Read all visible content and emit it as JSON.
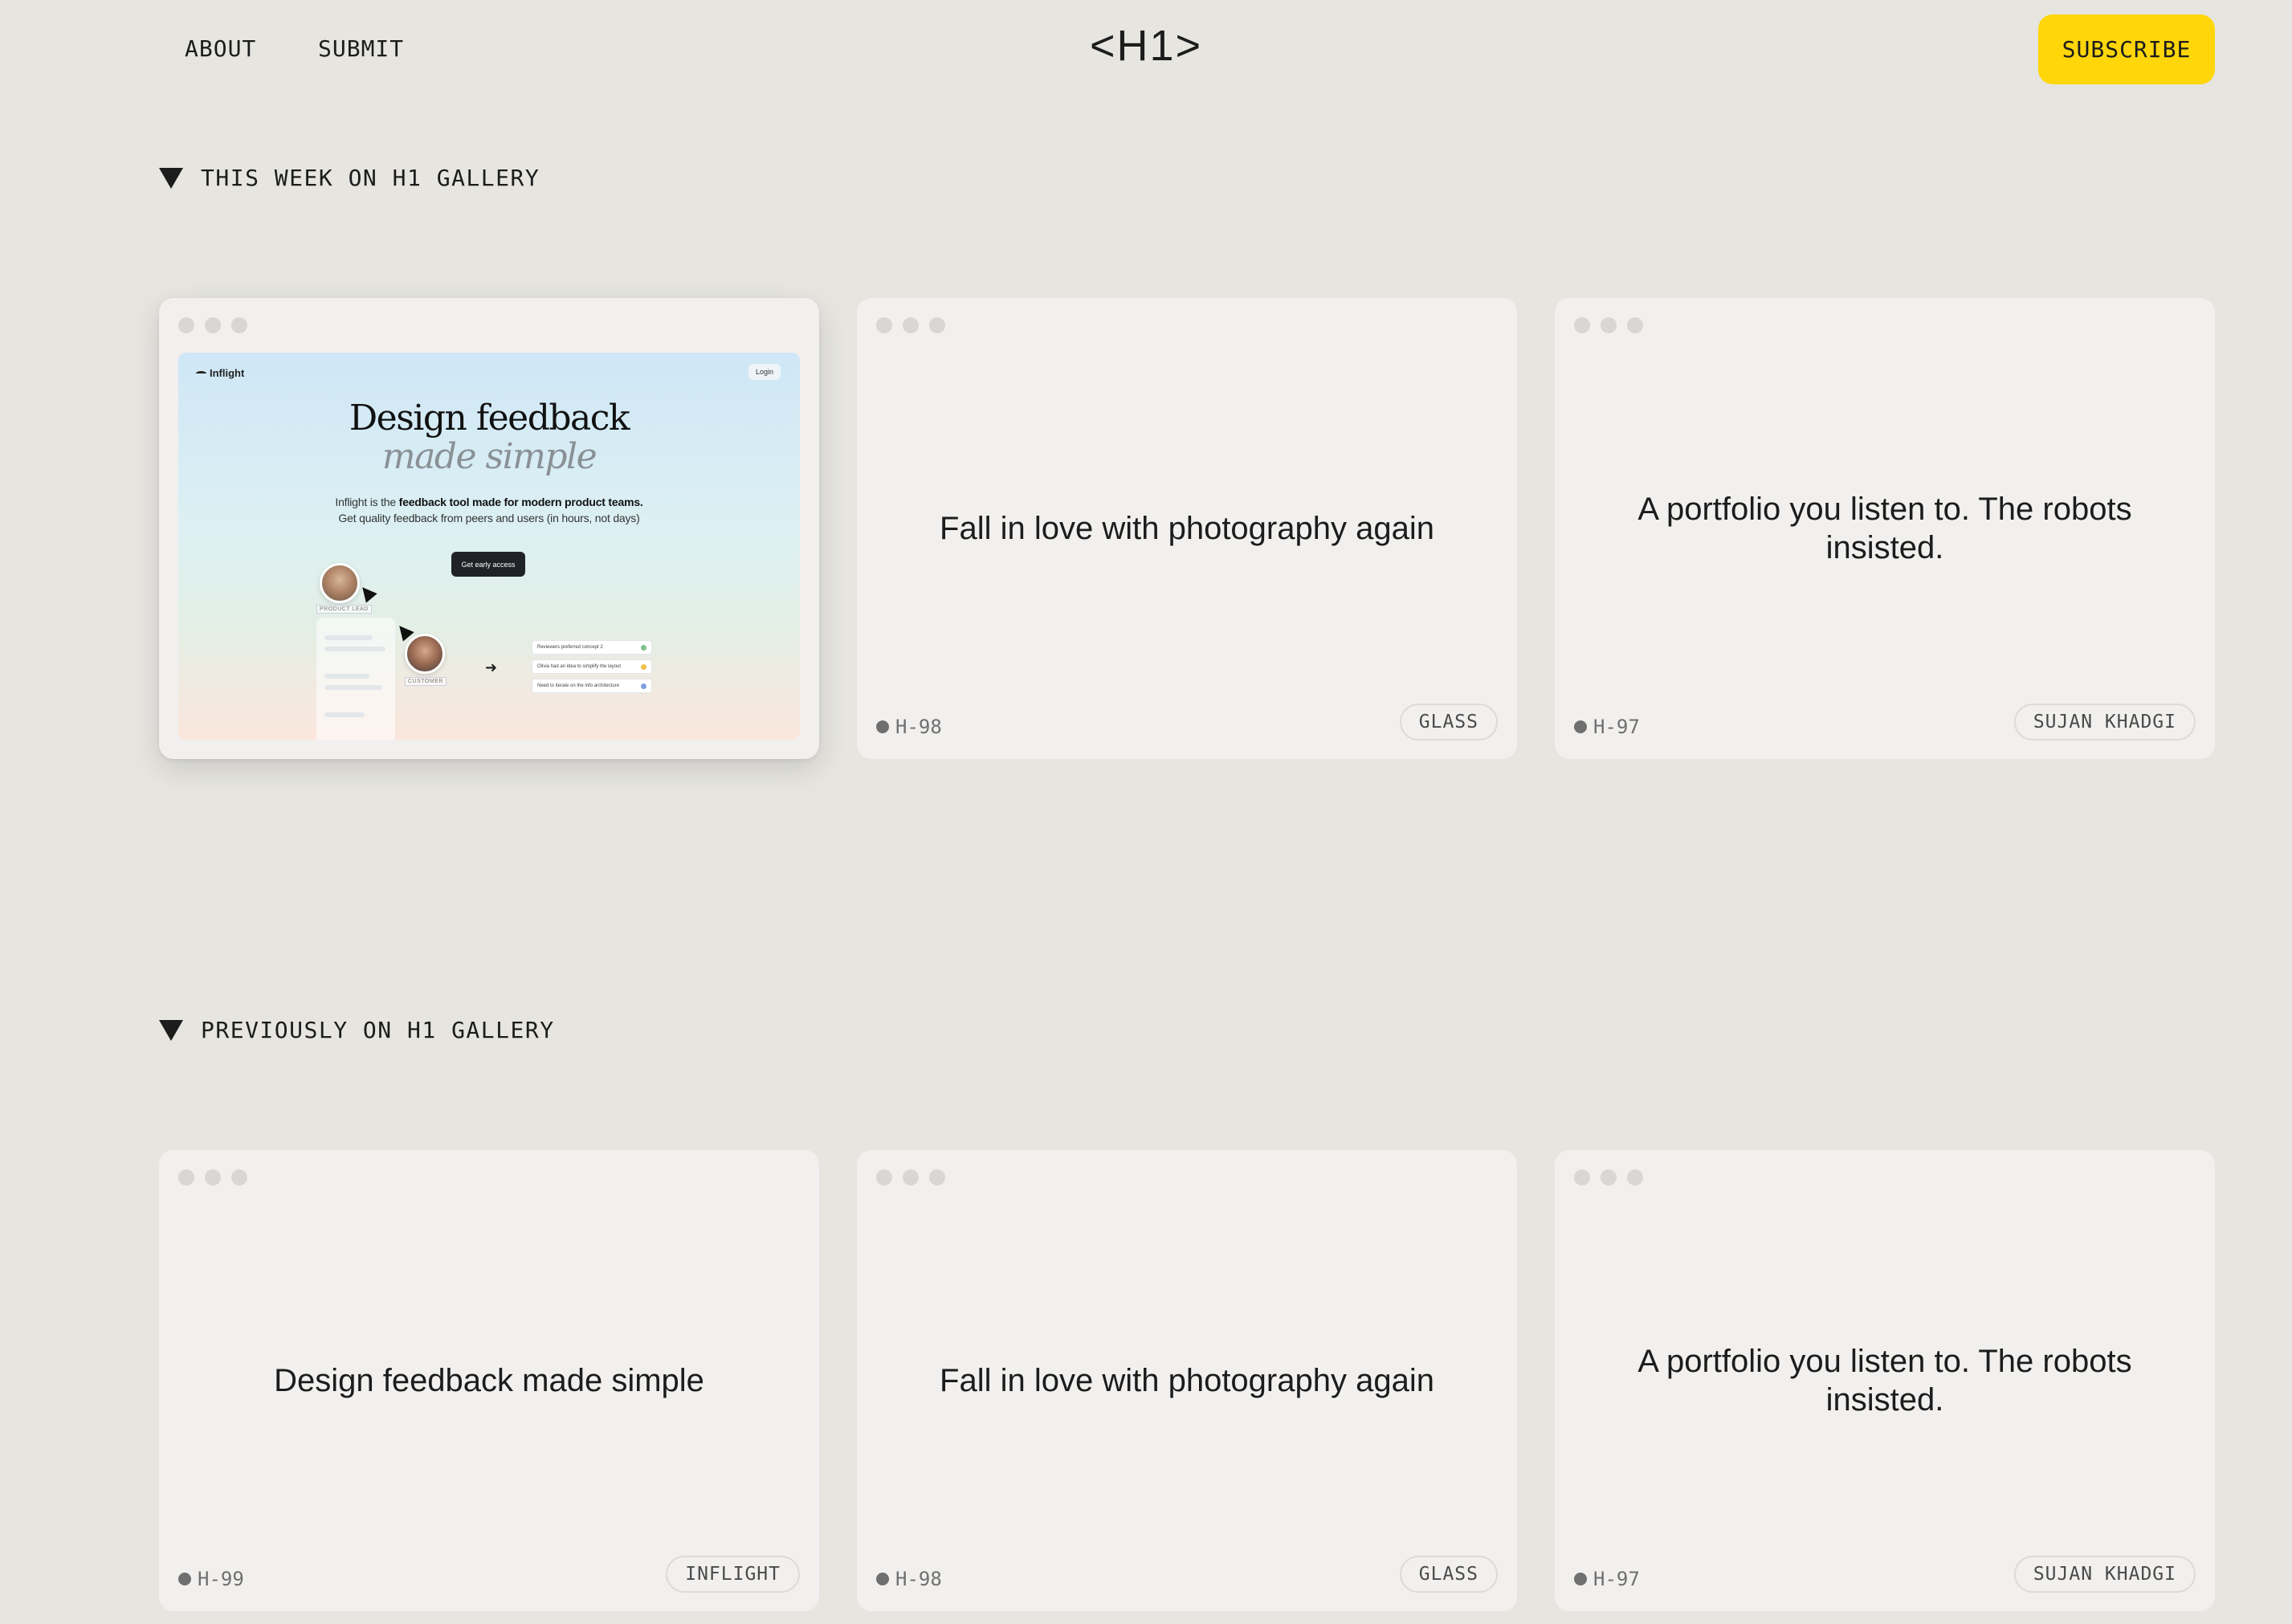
{
  "header": {
    "nav": [
      {
        "label": "ABOUT"
      },
      {
        "label": "SUBMIT"
      }
    ],
    "logo": "<H1>",
    "subscribe_label": "SUBSCRIBE"
  },
  "sections": [
    {
      "title": "THIS WEEK ON H1 GALLERY",
      "cards": [
        {
          "title": "Design feedback made simple",
          "featured": true,
          "preview": {
            "brand": "Inflight",
            "login": "Login",
            "headline": "Design feedback",
            "headline_italic": "made simple",
            "sub_prefix": "Inflight is the ",
            "sub_bold": "feedback tool made for modern product teams.",
            "sub_line2": "Get quality feedback from peers and users (in hours, not days)",
            "cta": "Get early access",
            "role_1": "PRODUCT LEAD",
            "role_2": "CUSTOMER",
            "list": [
              {
                "text": "Reviewers preferred concept 2",
                "color": "#7fbf8a"
              },
              {
                "text": "Olivia had an idea to simplify the layout",
                "color": "#f2c14e"
              },
              {
                "text": "Need to iterate on the info architecture",
                "color": "#7f9fe0"
              }
            ]
          }
        },
        {
          "title": "Fall in love with photography again",
          "id": "H-98",
          "tag": "GLASS"
        },
        {
          "title": "A portfolio you listen to. The robots insisted.",
          "id": "H-97",
          "tag": "SUJAN KHADGI"
        }
      ]
    },
    {
      "title": "PREVIOUSLY ON H1 GALLERY",
      "cards": [
        {
          "title": "Design feedback made simple",
          "id": "H-99",
          "tag": "INFLIGHT"
        },
        {
          "title": "Fall in love with photography again",
          "id": "H-98",
          "tag": "GLASS"
        },
        {
          "title": "A portfolio you listen to. The robots insisted.",
          "id": "H-97",
          "tag": "SUJAN KHADGI"
        }
      ]
    }
  ],
  "colors": {
    "background": "#e6e5e0",
    "card": "#f1f0ee",
    "accent": "#ffd60a",
    "text": "#1c1c1c"
  }
}
